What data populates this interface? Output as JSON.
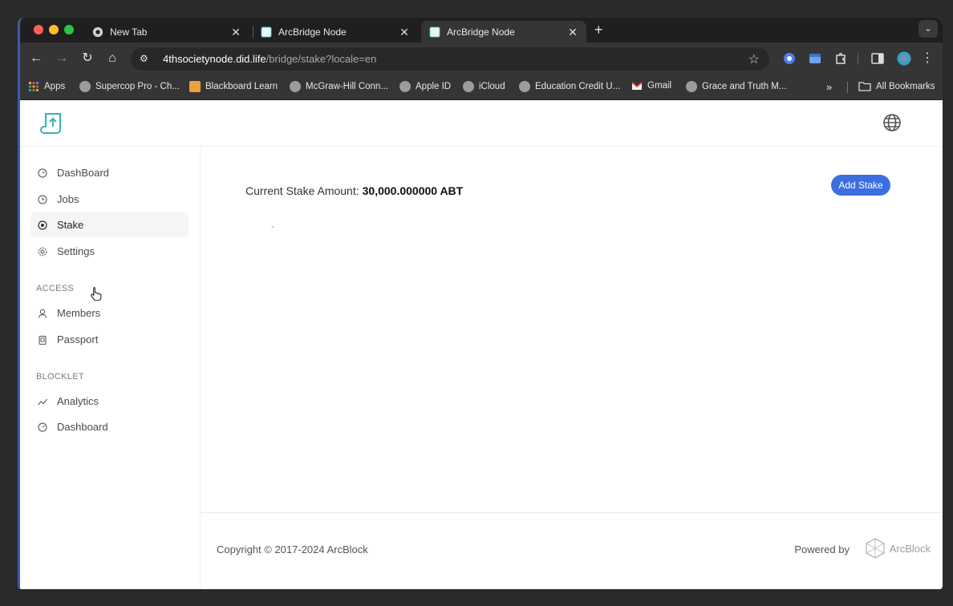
{
  "browser": {
    "tabs": [
      {
        "title": "New Tab"
      },
      {
        "title": "ArcBridge Node"
      },
      {
        "title": "ArcBridge Node"
      }
    ],
    "url_host": "4thsocietynode.did.life",
    "url_path": "/bridge/stake?locale=en",
    "bookmarks": [
      {
        "label": "Apps"
      },
      {
        "label": "Supercop Pro - Ch..."
      },
      {
        "label": "Blackboard Learn"
      },
      {
        "label": "McGraw-Hill Conn..."
      },
      {
        "label": "Apple ID"
      },
      {
        "label": "iCloud"
      },
      {
        "label": "Education Credit U..."
      },
      {
        "label": "Gmail"
      },
      {
        "label": "Grace and Truth M..."
      }
    ],
    "all_bookmarks": "All Bookmarks"
  },
  "sidebar": {
    "items": [
      {
        "label": "DashBoard",
        "icon": "gauge-icon"
      },
      {
        "label": "Jobs",
        "icon": "clock-icon"
      },
      {
        "label": "Stake",
        "icon": "target-icon",
        "active": true
      },
      {
        "label": "Settings",
        "icon": "gear-icon"
      }
    ],
    "access_label": "ACCESS",
    "access_items": [
      {
        "label": "Members",
        "icon": "user-icon"
      },
      {
        "label": "Passport",
        "icon": "clipboard-icon"
      }
    ],
    "blocklet_label": "BLOCKLET",
    "blocklet_items": [
      {
        "label": "Analytics",
        "icon": "trend-icon"
      },
      {
        "label": "Dashboard",
        "icon": "gauge-icon"
      }
    ]
  },
  "main": {
    "stake_label": "Current Stake Amount:",
    "stake_value": "30,000.000000 ABT",
    "add_stake": "Add Stake",
    "placeholder_dash": "-"
  },
  "footer": {
    "copyright": "Copyright © 2017-2024  ArcBlock",
    "powered_by": "Powered by",
    "brand": "ArcBlock"
  },
  "colors": {
    "accent": "#3b6fe0",
    "logo": "#36b3b3"
  }
}
